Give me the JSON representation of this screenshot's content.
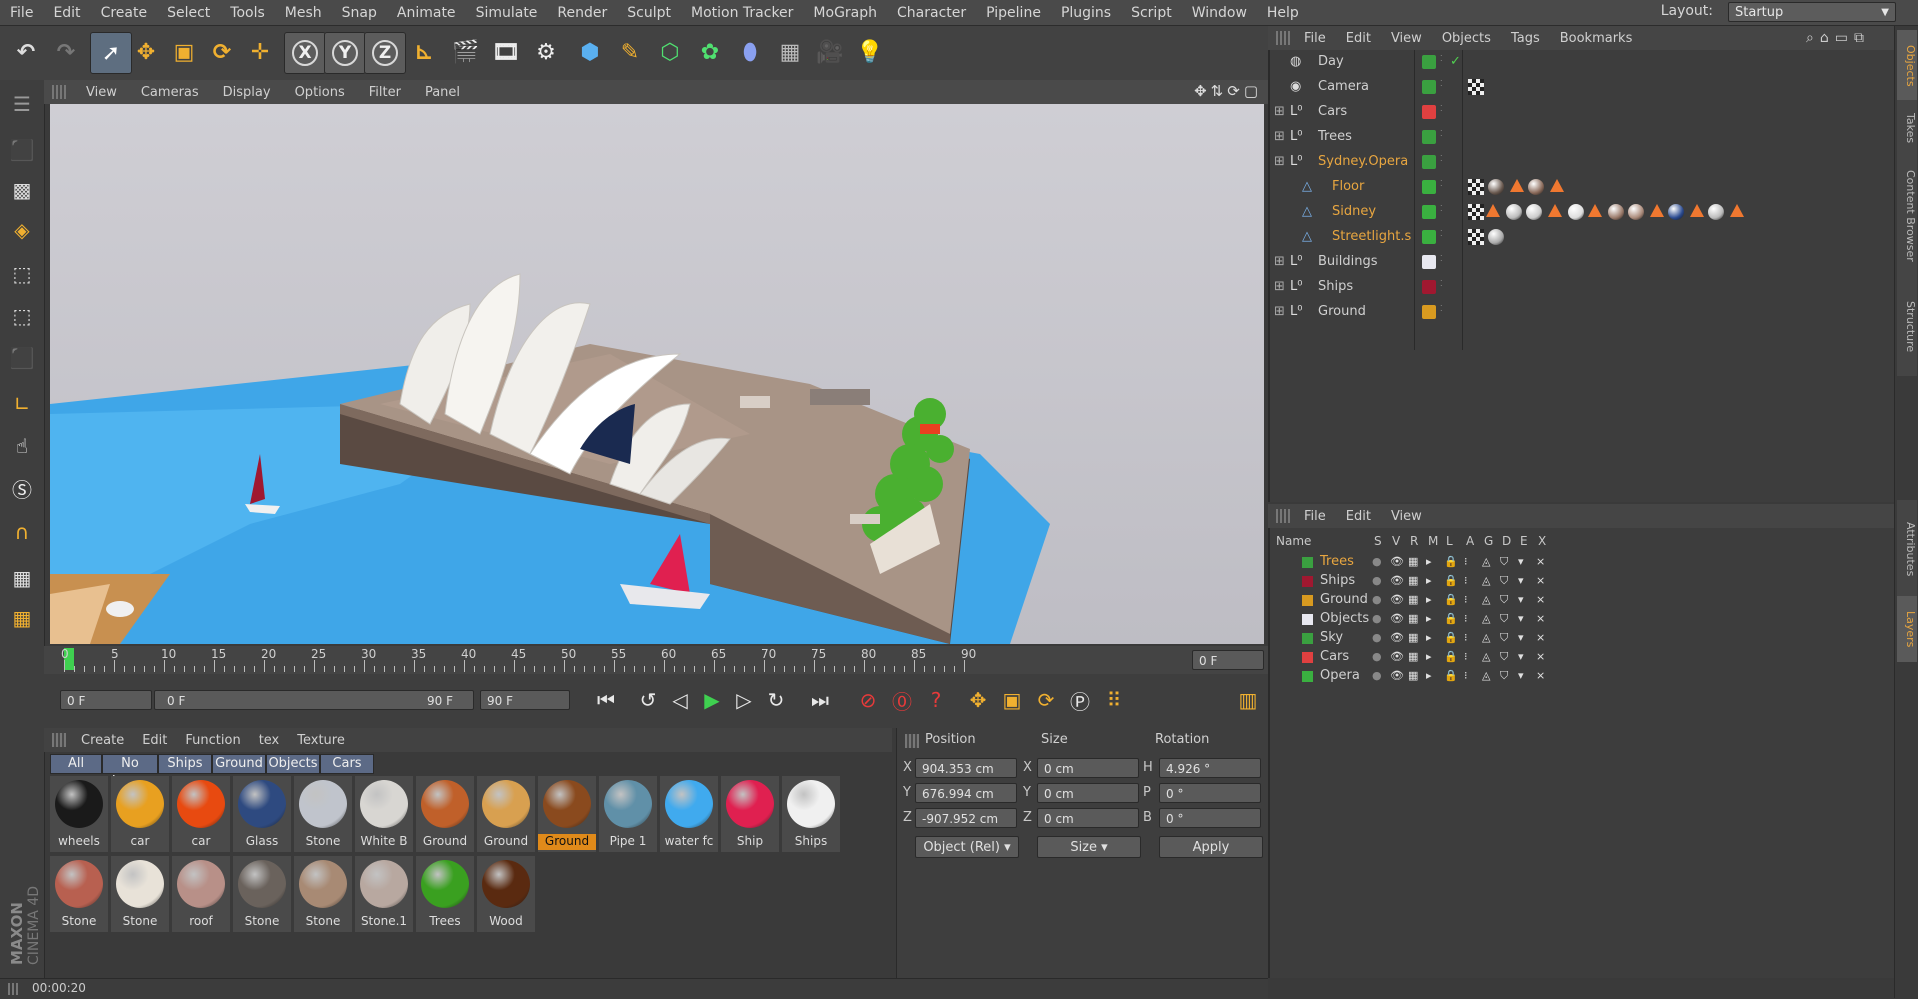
{
  "menu": [
    "File",
    "Edit",
    "Create",
    "Select",
    "Tools",
    "Mesh",
    "Snap",
    "Animate",
    "Simulate",
    "Render",
    "Sculpt",
    "Motion Tracker",
    "MoGraph",
    "Character",
    "Pipeline",
    "Plugins",
    "Script",
    "Window",
    "Help"
  ],
  "layout": {
    "label": "Layout:",
    "value": "Startup"
  },
  "viewport_menu": [
    "View",
    "Cameras",
    "Display",
    "Options",
    "Filter",
    "Panel"
  ],
  "timeline": {
    "ticks": [
      "0",
      "5",
      "10",
      "15",
      "20",
      "25",
      "30",
      "35",
      "40",
      "45",
      "50",
      "55",
      "60",
      "65",
      "70",
      "75",
      "80",
      "85",
      "90"
    ],
    "current_frame": "0 F"
  },
  "playback": {
    "start": "0 F",
    "range_start": "0 F",
    "range_end": "90 F",
    "end": "90 F"
  },
  "material_menu": [
    "Create",
    "Edit",
    "Function",
    "tex",
    "Texture"
  ],
  "material_tabs": [
    "All",
    "No Layer",
    "Ships",
    "Ground",
    "Objects",
    "Cars"
  ],
  "materials": [
    {
      "name": "wheels",
      "color": "#1a1a1a"
    },
    {
      "name": "car",
      "color": "#e8a020"
    },
    {
      "name": "car",
      "color": "#e84a10"
    },
    {
      "name": "Glass",
      "color": "#2e4a80"
    },
    {
      "name": "Stone",
      "color": "#c0c4cc"
    },
    {
      "name": "White B",
      "color": "#d8d6d2"
    },
    {
      "name": "Ground",
      "color": "#c0602a"
    },
    {
      "name": "Ground",
      "color": "#d8a050"
    },
    {
      "name": "Ground",
      "color": "#8a4a1e",
      "selected": true
    },
    {
      "name": "Pipe 1",
      "color": "#6090a8"
    },
    {
      "name": "water fc",
      "color": "#40aaee"
    },
    {
      "name": "Ship",
      "color": "#e02050"
    },
    {
      "name": "Ships",
      "color": "#f0f0f0"
    },
    {
      "name": "Stone",
      "color": "#b86050"
    },
    {
      "name": "Stone",
      "color": "#e8e2d8"
    },
    {
      "name": "roof",
      "color": "#b89088"
    },
    {
      "name": "Stone",
      "color": "#6a625c"
    },
    {
      "name": "Stone",
      "color": "#a88a74"
    },
    {
      "name": "Stone.1",
      "color": "#b8a8a0"
    },
    {
      "name": "Trees",
      "color": "#3aa020"
    },
    {
      "name": "Wood",
      "color": "#5a2a10"
    }
  ],
  "coordinates": {
    "headers": [
      "Position",
      "Size",
      "Rotation"
    ],
    "rows": [
      {
        "axis": "X",
        "pos": "904.353 cm",
        "sizeaxis": "X",
        "size": "0 cm",
        "rotaxis": "H",
        "rot": "4.926 °"
      },
      {
        "axis": "Y",
        "pos": "676.994 cm",
        "sizeaxis": "Y",
        "size": "0 cm",
        "rotaxis": "P",
        "rot": "0 °"
      },
      {
        "axis": "Z",
        "pos": "-907.952 cm",
        "sizeaxis": "Z",
        "size": "0 cm",
        "rotaxis": "B",
        "rot": "0 °"
      }
    ],
    "mode": "Object (Rel)",
    "size_mode": "Size",
    "apply": "Apply"
  },
  "status_time": "00:00:20",
  "object_menu": [
    "File",
    "Edit",
    "View",
    "Objects",
    "Tags",
    "Bookmarks"
  ],
  "objects": [
    {
      "name": "Day",
      "icon": "sky",
      "color": "#3aa040",
      "indent": 0,
      "expand": false,
      "check": true
    },
    {
      "name": "Camera",
      "icon": "camera",
      "color": "#3aa040",
      "indent": 0,
      "expand": false
    },
    {
      "name": "Cars",
      "icon": "null",
      "color": "#e04040",
      "indent": 0,
      "expand": true
    },
    {
      "name": "Trees",
      "icon": "null",
      "color": "#3aa040",
      "indent": 0,
      "expand": true
    },
    {
      "name": "Sydney.Opera",
      "icon": "null",
      "color": "#3aa040",
      "indent": 0,
      "expand": true,
      "highlight": true
    },
    {
      "name": "Floor",
      "icon": "poly",
      "color": "#3ab040",
      "indent": 1,
      "highlight": true
    },
    {
      "name": "Sidney",
      "icon": "poly",
      "color": "#3ab040",
      "indent": 1,
      "highlight": true
    },
    {
      "name": "Streetlight.s",
      "icon": "poly",
      "color": "#3ab040",
      "indent": 1,
      "highlight": true
    },
    {
      "name": "Buildings",
      "icon": "null",
      "color": "#e8e8f0",
      "indent": 0,
      "expand": true
    },
    {
      "name": "Ships",
      "icon": "null",
      "color": "#a01830",
      "indent": 0,
      "expand": true
    },
    {
      "name": "Ground",
      "icon": "null",
      "color": "#d89a20",
      "indent": 0,
      "expand": true
    }
  ],
  "layer_menu": [
    "File",
    "Edit",
    "View"
  ],
  "layer_headers": [
    "Name",
    "S",
    "V",
    "R",
    "M",
    "L",
    "A",
    "G",
    "D",
    "E",
    "X"
  ],
  "layers": [
    {
      "name": "Trees",
      "color": "#3aa040",
      "highlight": true
    },
    {
      "name": "Ships",
      "color": "#a01830"
    },
    {
      "name": "Ground",
      "color": "#d89a20"
    },
    {
      "name": "Objects",
      "color": "#e8e8f0"
    },
    {
      "name": "Sky",
      "color": "#3aa040"
    },
    {
      "name": "Cars",
      "color": "#e04040"
    },
    {
      "name": "Opera",
      "color": "#3ab040"
    }
  ],
  "side_tabs": [
    "Objects",
    "Takes",
    "Content Browser",
    "Structure",
    "Attributes",
    "Layers"
  ],
  "logo": {
    "brand": "MAXON",
    "product": "CINEMA 4D"
  }
}
